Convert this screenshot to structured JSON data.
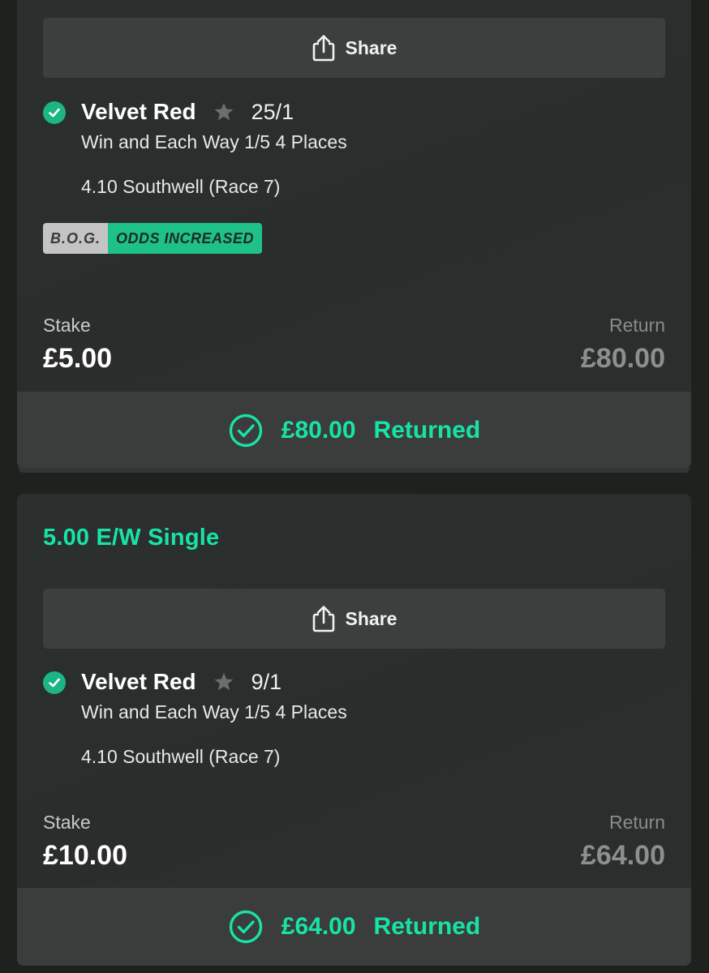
{
  "colors": {
    "accent": "#18e3a5",
    "tick_green": "#1cb583",
    "card_bg": "#2b2f2d",
    "button_bg": "#3b3f3d"
  },
  "bets": [
    {
      "title": "",
      "share_label": "Share",
      "selection": {
        "runner": "Velvet Red",
        "odds": "25/1",
        "market": "Win and Each Way 1/5 4 Places",
        "event": "4.10 Southwell (Race 7)",
        "status_icon": "check-circle-icon",
        "favourite_icon": "star-icon"
      },
      "badge": {
        "left": "B.O.G.",
        "right": "ODDS INCREASED"
      },
      "stake_label": "Stake",
      "stake": "£5.00",
      "return_label": "Return",
      "return": "£80.00",
      "returned_amount": "£80.00",
      "returned_label": "Returned"
    },
    {
      "title": "5.00 E/W Single",
      "share_label": "Share",
      "selection": {
        "runner": "Velvet Red",
        "odds": "9/1",
        "market": "Win and Each Way 1/5 4 Places",
        "event": "4.10 Southwell (Race 7)",
        "status_icon": "check-circle-icon",
        "favourite_icon": "star-icon"
      },
      "stake_label": "Stake",
      "stake": "£10.00",
      "return_label": "Return",
      "return": "£64.00",
      "returned_amount": "£64.00",
      "returned_label": "Returned"
    }
  ]
}
